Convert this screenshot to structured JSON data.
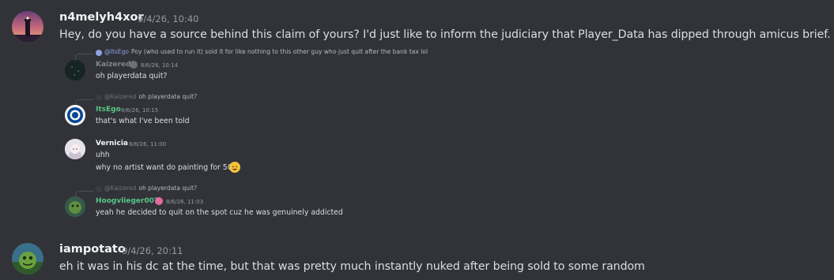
{
  "messages": [
    {
      "username": "n4melyh4xor",
      "timestamp": "9/4/26, 10:40",
      "content": "Hey, do you have a source behind this claim of yours? I'd just like to inform the judiciary that Player_Data has dipped through amicus brief."
    },
    {
      "username": "iampotato",
      "timestamp": "9/4/26, 20:11",
      "content": "eh it was in his dc at the time, but that was pretty much instantly nuked after being sold to some random"
    }
  ],
  "screenshot": {
    "messages": [
      {
        "reply_to": "@ItsEgo",
        "reply_text": "Poy (who used to run it) sold it for like nothing to this other guy who just quit after the bank tax lol",
        "username": "Kaizered",
        "username_color": "#80848e",
        "timestamp": "8/6/26, 10:14",
        "text": "oh playerdata quit?"
      },
      {
        "reply_to": "@Kaizered",
        "reply_text": "oh playerdata quit?",
        "username": "ItsEgo",
        "username_color": "#57c785",
        "timestamp": "8/6/26, 10:15",
        "text": "that's what I've been told"
      },
      {
        "username": "Vernicia",
        "username_color": "#f2f3f5",
        "timestamp": "8/6/26, 11:00",
        "text": "uhh",
        "text2": "why no artist want do painting for 50k"
      },
      {
        "reply_to": "@Kaizered",
        "reply_text": "oh playerdata quit?",
        "username": "Hoogvlieger007",
        "username_color": "#57c785",
        "timestamp": "8/6/26, 11:03",
        "text": "yeah he decided to quit on the spot cuz he was genuinely addicted"
      }
    ]
  }
}
